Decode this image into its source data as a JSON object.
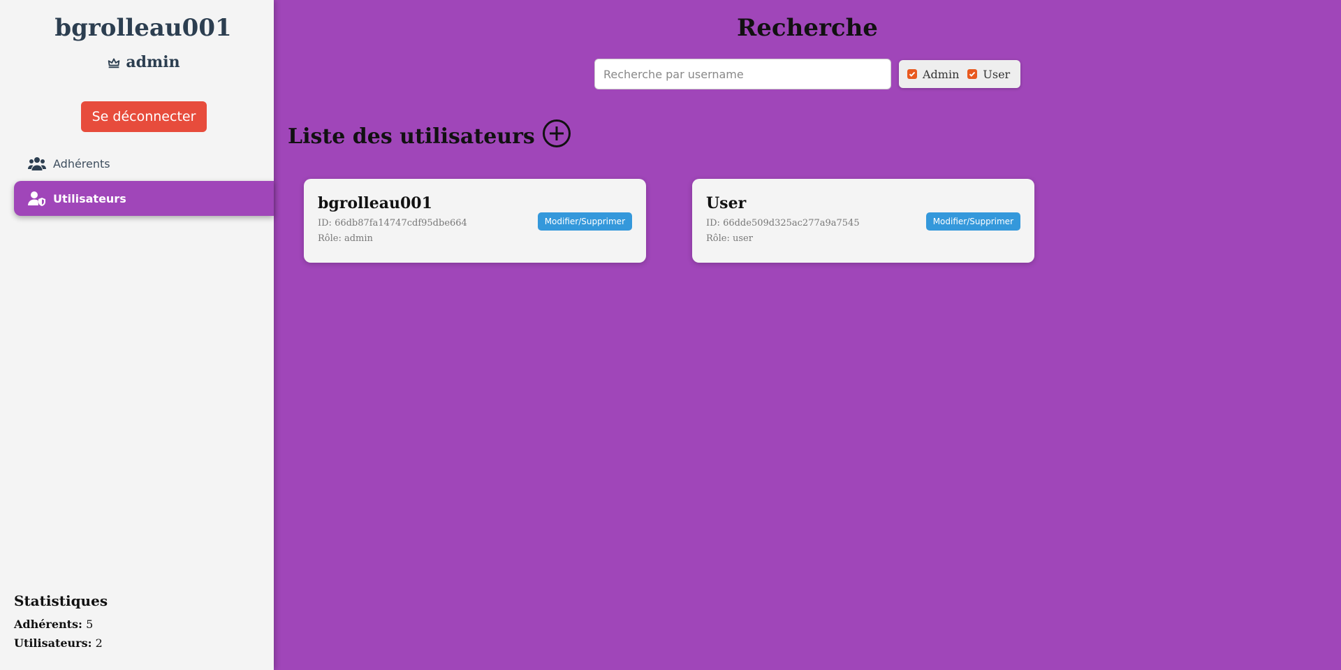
{
  "sidebar": {
    "username": "bgrolleau001",
    "role_icon": "crown-icon",
    "role": "admin",
    "logout_label": "Se déconnecter",
    "nav": [
      {
        "label": "Adhérents",
        "icon": "users-icon"
      },
      {
        "label": "Utilisateurs",
        "icon": "user-shield-icon",
        "active": true
      }
    ],
    "stats": {
      "title": "Statistiques",
      "adherents_label": "Adhérents:",
      "adherents_value": "5",
      "users_label": "Utilisateurs:",
      "users_value": "2"
    }
  },
  "main": {
    "title": "Recherche",
    "search": {
      "placeholder": "Recherche par username",
      "value": ""
    },
    "filters": [
      {
        "label": "Admin",
        "checked": true
      },
      {
        "label": "User",
        "checked": true
      }
    ],
    "section_title": "Liste des utilisateurs",
    "add_icon": "plus-circle-icon",
    "users": [
      {
        "name": "bgrolleau001",
        "id": "ID: 66db87fa14747cdf95dbe664",
        "role": "Rôle: admin",
        "action": "Modifier/Supprimer"
      },
      {
        "name": "User",
        "id": "ID: 66dde509d325ac277a9a7545",
        "role": "Rôle: user",
        "action": "Modifier/Supprimer"
      }
    ]
  },
  "colors": {
    "accent": "#a046b9",
    "sidebar_bg": "#f4f4f4",
    "logout": "#e74c3c",
    "card_button": "#3498db",
    "checkbox": "#e8591f",
    "heading": "#2c3e50"
  }
}
